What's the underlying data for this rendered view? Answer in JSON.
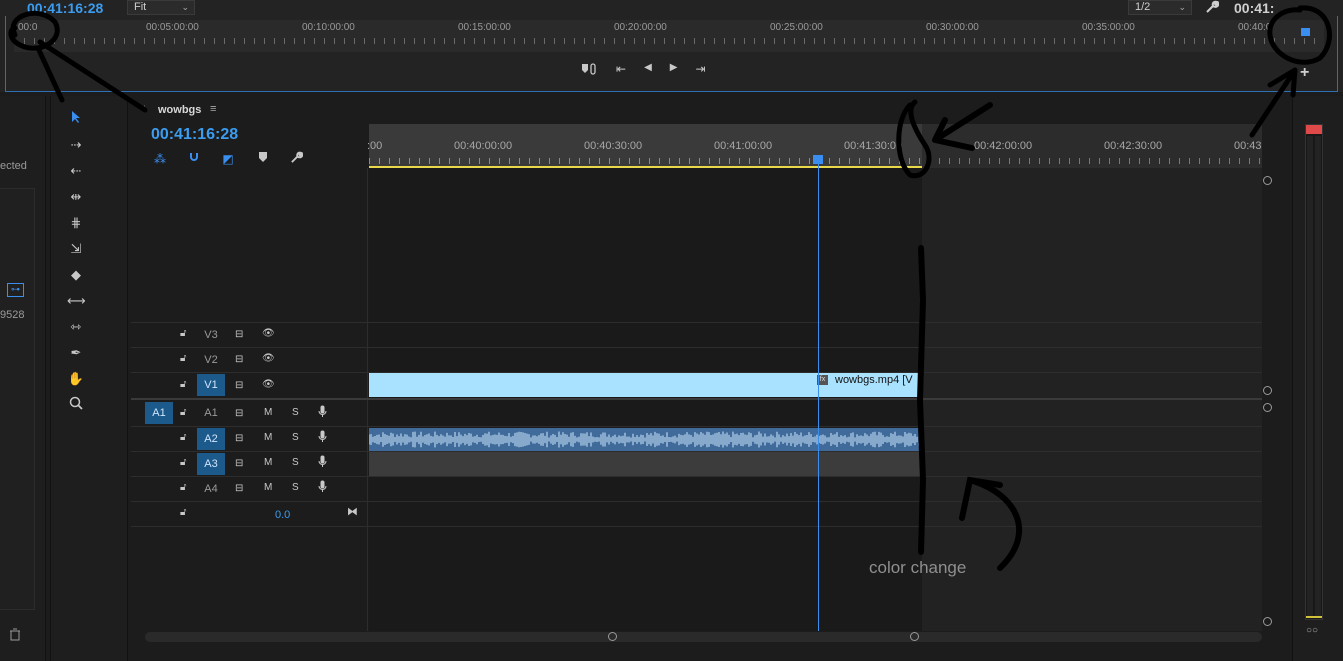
{
  "monitor": {
    "timecode_left": "00:41:16:28",
    "zoom_select": "Fit",
    "resolution_select": "1/2",
    "timecode_right": "00:41:",
    "ruler_labels": [
      "00:0",
      "00:05:00:00",
      "00:10:00:00",
      "00:15:00:00",
      "00:20:00:00",
      "00:25:00:00",
      "00:30:00:00",
      "00:35:00:00",
      "00:40:0"
    ],
    "controls": {
      "marker_icon": "marker-link-icon",
      "go_in": "⇤",
      "step_back": "◀",
      "step_forward": "▶",
      "go_out": "⇥"
    },
    "add_button": "+"
  },
  "left_panel": {
    "text_top": "ected",
    "text_bottom": "9528"
  },
  "timeline": {
    "tab_name": "wowbgs",
    "tab_menu": "≡",
    "timecode": "00:41:16:28",
    "ruler_labels": [
      ":00",
      "00:40:00:00",
      "00:40:30:00",
      "00:41:00:00",
      "00:41:30:00",
      "00:42:00:00",
      "00:42:30:00",
      "00:43"
    ],
    "tracks": {
      "video": [
        {
          "name": "V3",
          "active": false
        },
        {
          "name": "V2",
          "active": false
        },
        {
          "name": "V1",
          "active": true
        }
      ],
      "audio": [
        {
          "source": "A1",
          "name": "A1",
          "active": false
        },
        {
          "source": "",
          "name": "A2",
          "active": true
        },
        {
          "source": "",
          "name": "A3",
          "active": true
        },
        {
          "source": "",
          "name": "A4",
          "active": false
        }
      ]
    },
    "audio_controls": {
      "mute": "M",
      "solo": "S"
    },
    "master_value": "0.0",
    "clip_label": "wowbgs.mp4 [V",
    "fx_badge": "fx"
  },
  "meter": {
    "solo_indicator": "○○"
  },
  "annotation": {
    "text": "color change"
  },
  "colors": {
    "accent": "#3b9cf0",
    "video_clip": "#a9e2ff",
    "audio_clip": "#3f6a9a",
    "work_area": "#e8d84a",
    "peak": "#e0494a"
  }
}
